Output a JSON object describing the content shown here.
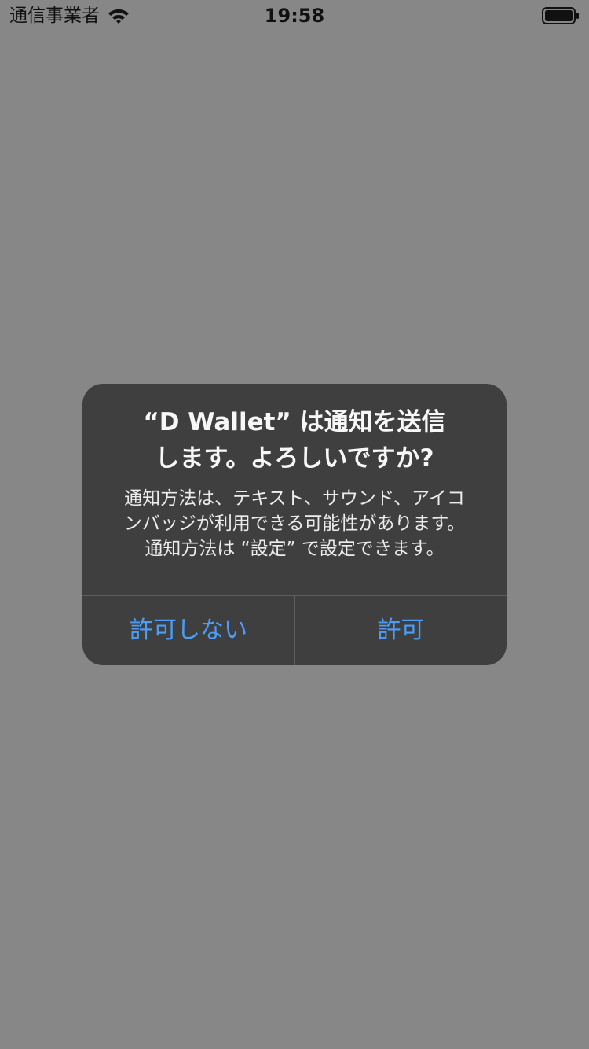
{
  "status_bar": {
    "carrier": "通信事業者",
    "time": "19:58",
    "wifi_icon": "wifi-icon",
    "battery_icon": "battery-icon"
  },
  "alert": {
    "title": "“D Wallet” は通知を送信\nします。よろしいですか?",
    "message": "通知方法は、テキスト、サウンド、アイコ\nンバッジが利用できる可能性があります。\n通知方法は “設定” で設定できます。",
    "deny_label": "許可しない",
    "allow_label": "許可"
  },
  "colors": {
    "overlay": "#878787",
    "alert_background": "#3f3f3f",
    "button_text": "#4b9ef8",
    "title_text": "#f7f7f7"
  }
}
